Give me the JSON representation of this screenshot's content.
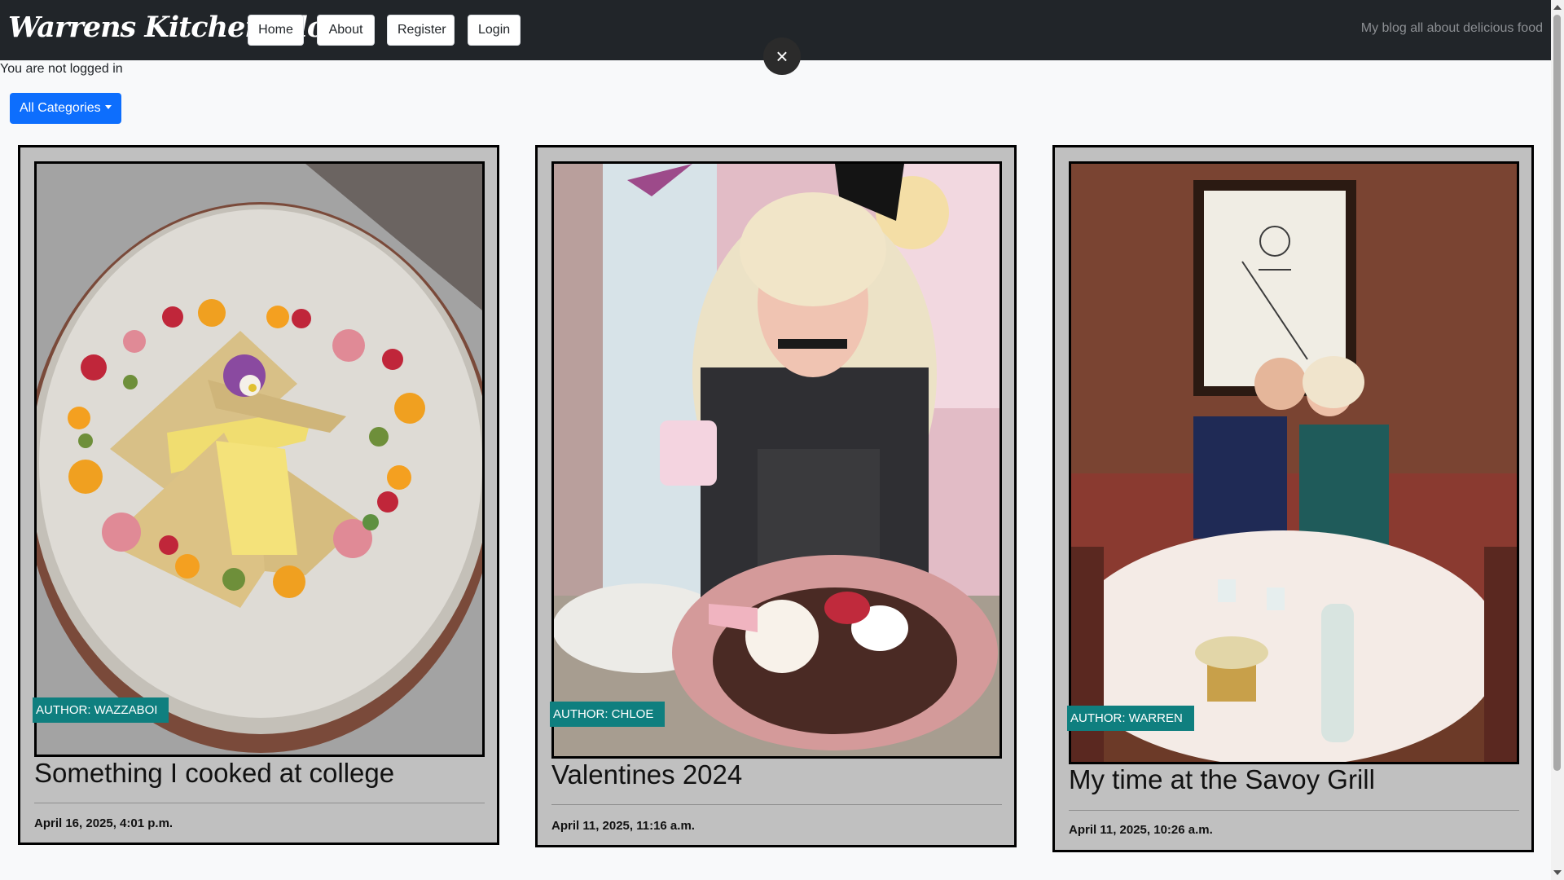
{
  "navbar": {
    "brand": "Warrens Kitchen Blog",
    "links": [
      "Home",
      "About",
      "Register",
      "Login"
    ],
    "tagline": "My blog all about delicious food"
  },
  "overlay": {
    "close_symbol": "×"
  },
  "status": {
    "login_text": "You are not logged in"
  },
  "filter": {
    "category_label": "All Categories"
  },
  "posts": [
    {
      "author": "AUTHOR: WAZZABOI",
      "title": "Something I cooked at college",
      "date": "April 16, 2025, 4:01 p.m."
    },
    {
      "author": "AUTHOR: CHLOE",
      "title": "Valentines 2024",
      "date": "April 11, 2025, 11:16 a.m."
    },
    {
      "author": "AUTHOR: WARREN",
      "title": "My time at the Savoy Grill",
      "date": "April 11, 2025, 10:26 a.m."
    }
  ],
  "colors": {
    "navbar_bg": "#212529",
    "page_bg": "#f8f9fa",
    "card_bg": "#c0c0c0",
    "author_badge": "#0f7f7f",
    "primary_button": "#0d6efd"
  },
  "icons": {
    "close": "close-icon",
    "caret": "caret-down-icon",
    "scroll_up": "scroll-up-arrow-icon",
    "scroll_down": "scroll-down-arrow-icon"
  }
}
